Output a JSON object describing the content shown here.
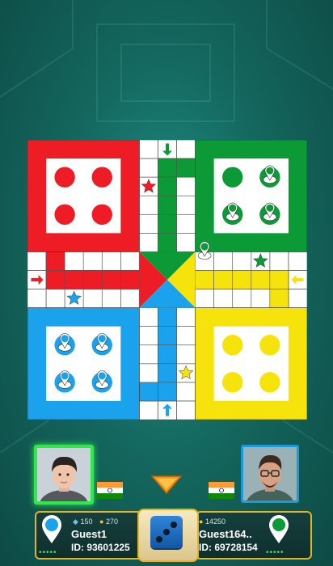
{
  "colors": {
    "red": "#ee1c24",
    "green": "#0b9a36",
    "yellow": "#f7e30c",
    "blue": "#1aa3ec",
    "active_player_frame": "#2ee84c",
    "panel_border": "#e6b325"
  },
  "board": {
    "safe_star_icon": "star-icon",
    "entry_arrow_icon": "arrow-icon",
    "home_tokens": {
      "red": 0,
      "green": 3,
      "yellow": 0,
      "blue": 4
    },
    "tokens_on_track": [
      {
        "color": "green",
        "count": 1
      }
    ]
  },
  "players": {
    "player1": {
      "name": "Guest1",
      "id": "ID: 93601225",
      "gems": "150",
      "coins": "270",
      "color": "blue",
      "active": true
    },
    "player2": {
      "name": "Guest164..",
      "id": "ID: 69728154",
      "coins": "14250",
      "color": "green",
      "active": false
    }
  },
  "dice": {
    "value": 3
  },
  "icons": {
    "gem": "gem-icon",
    "coin": "coin-icon",
    "location_pin": "location-pin-icon",
    "flag": "india-flag-icon",
    "turn_indicator": "turn-arrow-icon"
  }
}
